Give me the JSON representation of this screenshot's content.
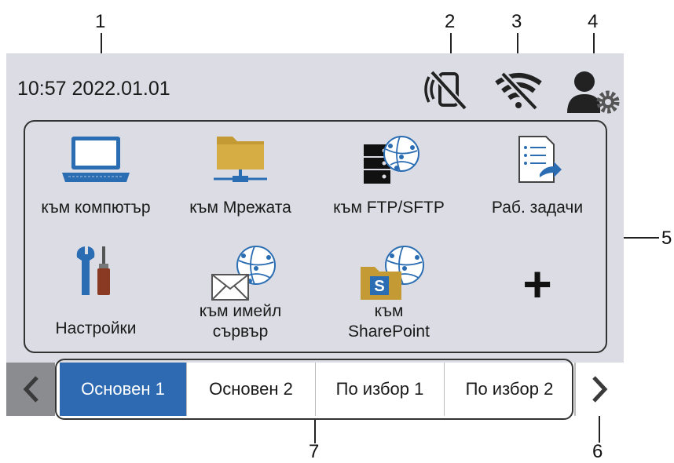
{
  "callouts": [
    "1",
    "2",
    "3",
    "4",
    "5",
    "6",
    "7"
  ],
  "status": {
    "datetime": "10:57 2022.01.01"
  },
  "tiles": [
    {
      "label": "към компютър",
      "icon": "laptop-icon"
    },
    {
      "label": "към Мрежата",
      "icon": "network-folder-icon"
    },
    {
      "label": "към FTP/SFTP",
      "icon": "ftp-server-icon"
    },
    {
      "label": "Раб. задачи",
      "icon": "workflow-icon"
    },
    {
      "label": "Настройки",
      "icon": "tools-icon"
    },
    {
      "label_line1": "към имейл",
      "label_line2": "сървър",
      "icon": "email-server-icon"
    },
    {
      "label_line1": "към",
      "label_line2": "SharePoint",
      "icon": "sharepoint-icon"
    },
    {
      "label": "+",
      "icon": "add-icon"
    }
  ],
  "tabs": [
    "Основен 1",
    "Основен 2",
    "По избор 1",
    "По избор 2"
  ],
  "colors": {
    "accent": "#2d6ab2",
    "screen": "#dcdde4",
    "folder": "#c49a34",
    "network_blue": "#2b6db3"
  }
}
